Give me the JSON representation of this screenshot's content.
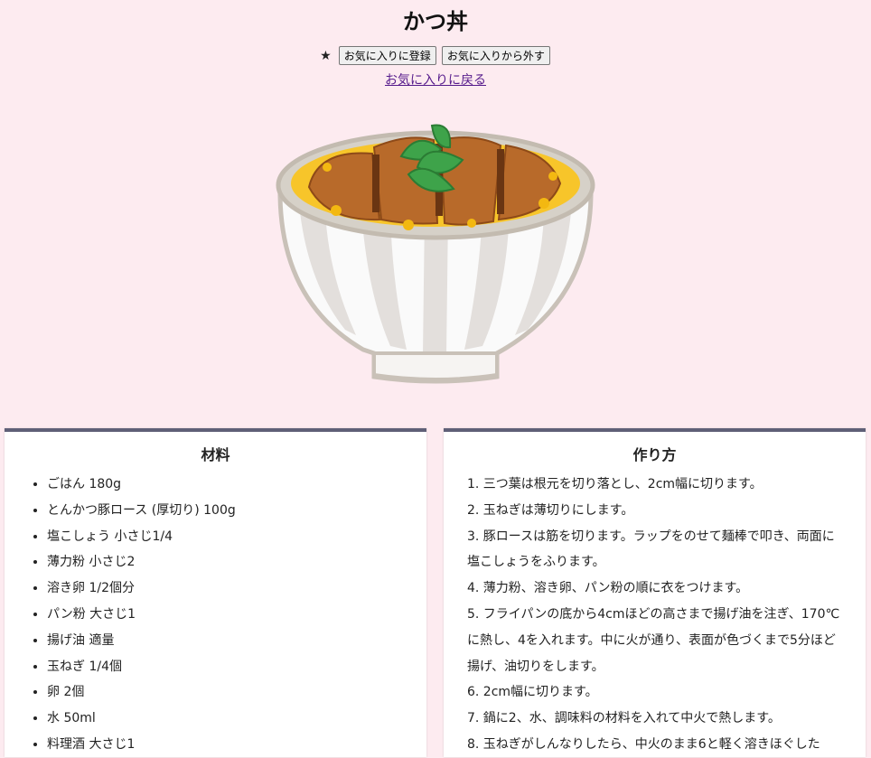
{
  "page_title": "かつ丼",
  "favorite": {
    "star": "★",
    "add_label": "お気に入りに登録",
    "remove_label": "お気に入りから外す"
  },
  "back_link": "お気に入りに戻る",
  "ingredients": {
    "heading": "材料",
    "items": [
      "ごはん 180g",
      "とんかつ豚ロース (厚切り) 100g",
      "塩こしょう 小さじ1/4",
      "薄力粉 小さじ2",
      "溶き卵 1/2個分",
      "パン粉 大さじ1",
      "揚げ油 適量",
      "玉ねぎ 1/4個",
      "卵 2個",
      "水 50ml",
      "料理酒 大さじ1"
    ]
  },
  "steps": {
    "heading": "作り方",
    "items": [
      "1. 三つ葉は根元を切り落とし、2cm幅に切ります。",
      "2. 玉ねぎは薄切りにします。",
      "3. 豚ロースは筋を切ります。ラップをのせて麺棒で叩き、両面に塩こしょうをふります。",
      "4. 薄力粉、溶き卵、パン粉の順に衣をつけます。",
      "5. フライパンの底から4cmほどの高さまで揚げ油を注ぎ、170℃に熱し、4を入れます。中に火が通り、表面が色づくまで5分ほど揚げ、油切りをします。",
      "6. 2cm幅に切ります。",
      "7. 鍋に2、水、調味料の材料を入れて中火で熱します。",
      "8. 玉ねぎがしんなりしたら、中火のまま6と軽く溶きほぐした"
    ]
  },
  "illustration": {
    "icon": "katsudon-bowl-illustration"
  }
}
